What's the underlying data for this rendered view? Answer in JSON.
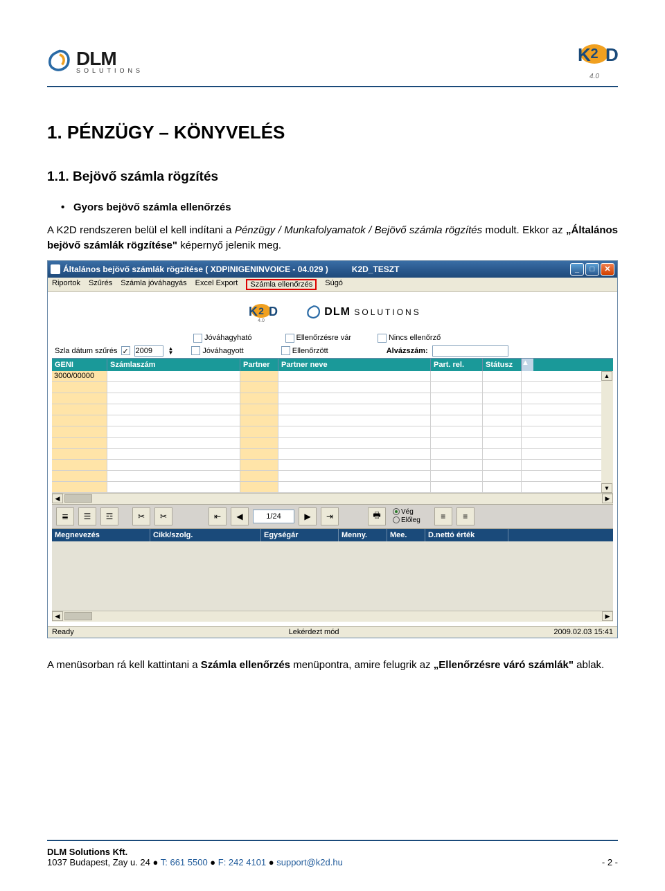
{
  "header": {
    "company": "DLM",
    "company_sub": "SOLUTIONS",
    "product": "K2D",
    "product_ver": "4.0"
  },
  "section": {
    "h1": "1.   PÉNZÜGY – KÖNYVELÉS",
    "h2": "1.1. Bejövő számla rögzítés",
    "bullet": "Gyors bejövő számla ellenőrzés",
    "p1_a": "A K2D rendszeren belül el kell indítani a ",
    "p1_b": "Pénzügy / Munkafolyamatok / Bejövő számla rögzítés",
    "p1_c": " modult. Ekkor az ",
    "p1_d": "„Általános bejövő számlák rögzítése\"",
    "p1_e": " képernyő jelenik meg.",
    "p2_a": "A menüsorban rá kell kattintani a ",
    "p2_b": "Számla ellenőrzés",
    "p2_c": " menüpontra, amire felugrik az ",
    "p2_d": "„Ellenőrzésre váró számlák\"",
    "p2_e": " ablak."
  },
  "app": {
    "title": "Általános bejövő számlák rögzítése ( XDPINIGENINVOICE - 04.029 )",
    "title_env": "K2D_TESZT",
    "menu": [
      "Riportok",
      "Szűrés",
      "Számla jóváhagyás",
      "Excel Export",
      "Számla ellenőrzés",
      "Súgó"
    ],
    "filters": {
      "date_lbl": "Szla dátum szűrés",
      "year": "2009",
      "jovahagy": "Jóváhagyható",
      "jovahagyott": "Jóváhagyott",
      "ellvar": "Ellenőrzésre vár",
      "ellzott": "Ellenőrzött",
      "nincs": "Nincs ellenőrző",
      "alvaz": "Alvázszám:"
    },
    "grid1": [
      "GENI",
      "Számlaszám",
      "Partner",
      "Partner neve",
      "Part. rel.",
      "Státusz"
    ],
    "first_cell": "3000/00000",
    "pager": "1/24",
    "radios": {
      "veg": "Vég",
      "eloleg": "Előleg"
    },
    "grid2": [
      "Megnevezés",
      "Cikk/szolg.",
      "Egységár",
      "Menny.",
      "Mee.",
      "D.nettó érték"
    ],
    "status": {
      "left": "Ready",
      "mid": "Lekérdezt mód",
      "right": "2009.02.03 15:41"
    }
  },
  "footer": {
    "name": "DLM Solutions Kft.",
    "addr": "1037 Budapest, Zay u. 24  ●  ",
    "tel": "T: 661 5500",
    "fsep": "  ●  ",
    "fax": "F: 242 4101",
    "esep": "  ●  ",
    "email": "support@k2d.hu",
    "page": "- 2 -"
  }
}
